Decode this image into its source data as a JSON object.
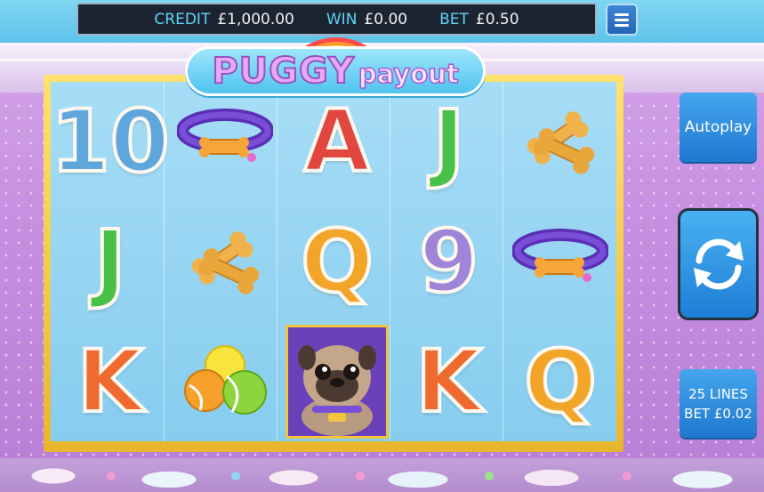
{
  "hud": {
    "credit_label": "CREDIT",
    "credit_value": "£1,000.00",
    "win_label": "WIN",
    "win_value": "£0.00",
    "bet_label": "BET",
    "bet_value": "£0.50"
  },
  "logo": {
    "part1": "PUGGY",
    "part2": "payout"
  },
  "reels": {
    "row1": [
      "10",
      "collar",
      "A",
      "J",
      "bones"
    ],
    "row2": [
      "J",
      "bones",
      "Q",
      "9",
      "collar"
    ],
    "row3": [
      "K",
      "tennis-balls",
      "pug",
      "K",
      "Q"
    ]
  },
  "glyphs": {
    "r1c1": "10",
    "r1c3": "A",
    "r1c4": "J",
    "r2c1": "J",
    "r2c3": "Q",
    "r2c4": "9",
    "r3c1": "K",
    "r3c4": "K",
    "r3c5": "Q"
  },
  "buttons": {
    "autoplay": "Autoplay",
    "lines": "25 LINES",
    "bet_per_line": "BET £0.02"
  },
  "colors": {
    "hud_label": "#5fd3f3",
    "button_blue": "#1f78cf",
    "frame_gold": "#e8b62c",
    "background_purple": "#c78fe0"
  },
  "icons": {
    "menu": "hamburger-menu-icon",
    "spin": "spin-arrows-icon"
  }
}
